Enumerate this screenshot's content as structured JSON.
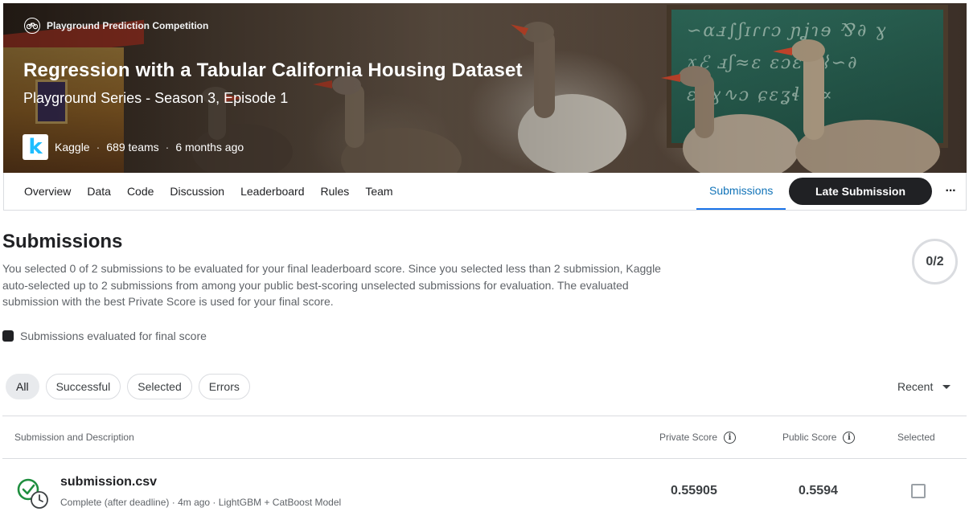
{
  "hero": {
    "competition_type": "Playground Prediction Competition",
    "title": "Regression with a Tabular California Housing Dataset",
    "subtitle": "Playground Series - Season 3, Episode 1",
    "host_name": "Kaggle",
    "host_logo_letter": "k",
    "teams": "689 teams",
    "time_ago": "6 months ago",
    "separator": "·"
  },
  "tabs": {
    "items": [
      "Overview",
      "Data",
      "Code",
      "Discussion",
      "Leaderboard",
      "Rules",
      "Team"
    ],
    "active": "Submissions",
    "late_submission_label": "Late Submission",
    "more_label": "···"
  },
  "page": {
    "title": "Submissions",
    "description": "You selected 0 of 2 submissions to be evaluated for your final leaderboard score. Since you selected less than 2 submission, Kaggle auto-selected up to 2 submissions from among your public best-scoring unselected submissions for evaluation. The evaluated submission with the best Private Score is used for your final score.",
    "counter": "0/2",
    "legend_label": "Submissions evaluated for final score"
  },
  "filters": {
    "chips": [
      "All",
      "Successful",
      "Selected",
      "Errors"
    ],
    "active": "All",
    "sort_label": "Recent"
  },
  "table": {
    "headers": {
      "description": "Submission and Description",
      "private": "Private Score",
      "public": "Public Score",
      "selected": "Selected"
    },
    "rows": [
      {
        "filename": "submission.csv",
        "meta": "Complete (after deadline) · 4m ago · LightGBM + CatBoost Model",
        "private_score": "0.55905",
        "public_score": "0.5594",
        "selected": false
      }
    ]
  },
  "colors": {
    "accent": "#1173b8",
    "dark_button": "#202124",
    "success": "#1e8e3e",
    "kaggle_blue": "#20beff"
  },
  "icons": {
    "competition_type": "bike-icon",
    "status": "check-clock-icon",
    "info": "info-icon",
    "sort": "caret-down-icon"
  }
}
